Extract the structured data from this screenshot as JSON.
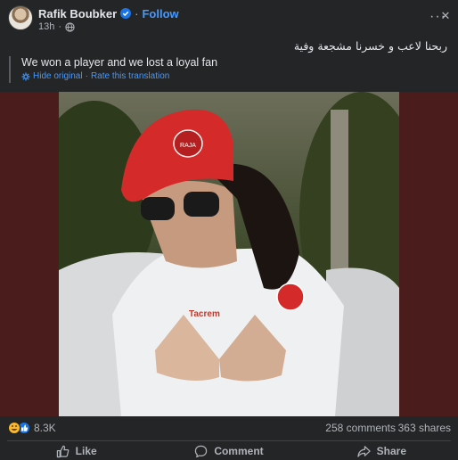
{
  "post": {
    "author": "Rafik Boubker",
    "follow_label": "Follow",
    "separator": "·",
    "time": "13h",
    "original_text": "ربحنا لاعب و خسرنا  مشجعة وفية",
    "translated_text": "We won a player and we lost a loyal fan",
    "hide_original_label": "Hide original",
    "rate_translation_label": "Rate this translation",
    "translation_separator": "·"
  },
  "photo": {
    "cap_text": "RAJA",
    "shirt_text": "Tacrem"
  },
  "reactions": {
    "count": "8.3K",
    "comments": "258 comments",
    "shares": "363 shares"
  },
  "actions": {
    "like_label": "Like",
    "comment_label": "Comment",
    "share_label": "Share"
  },
  "colors": {
    "background": "#242526",
    "accent": "#4599ff",
    "text": "#e4e6eb",
    "muted": "#b0b3b8",
    "media_background": "#4a1d1c"
  }
}
